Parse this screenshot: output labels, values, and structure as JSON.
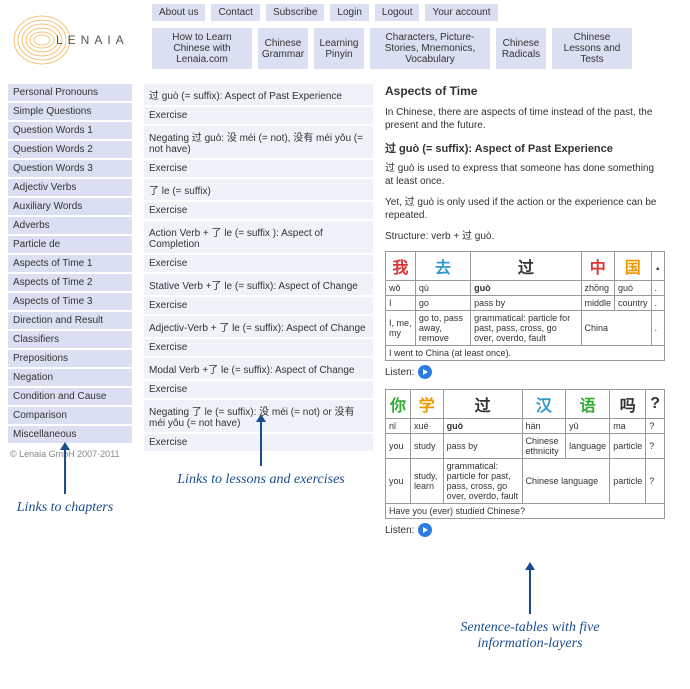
{
  "topnav": [
    "About us",
    "Contact",
    "Subscribe",
    "Login",
    "Logout",
    "Your account"
  ],
  "subnav": [
    "How to Learn Chinese with Lenaia.com",
    "Chinese Grammar",
    "Learning Pinyin",
    "Characters, Picture-Stories, Mnemonics, Vocabulary",
    "Chinese Radicals",
    "Chinese Lessons and Tests"
  ],
  "sidebar": [
    "Personal Pronouns",
    "Simple Questions",
    "Question Words 1",
    "Question Words 2",
    "Question Words 3",
    "Adjectiv Verbs",
    "Auxiliary Words",
    "Adverbs",
    "Particle de",
    "Aspects of Time 1",
    "Aspects of Time 2",
    "Aspects of Time 3",
    "Direction and Result",
    "Classifiers",
    "Prepositions",
    "Negation",
    "Condition and Cause",
    "Comparison",
    "Miscellaneous"
  ],
  "copyright": "© Lenaia GmbH 2007-2011",
  "lessons": [
    "过 guò (= suffix): Aspect of Past Experience",
    "Exercise",
    "Negating 过 guò: 没 méi (= not), 没有 méi yǒu (= not have)",
    "Exercise",
    "了 le (= suffix)",
    "Exercise",
    "Action Verb + 了 le (= suffix ): Aspect of Completion",
    "Exercise",
    "Stative Verb +了 le (= suffix): Aspect of Change",
    "Exercise",
    "Adjectiv-Verb + 了 le (= suffix): Aspect of Change",
    "Exercise",
    "Modal Verb +了 le (= suffix): Aspect of Change",
    "Exercise",
    "Negating 了 le (= suffix): 没 méi (= not) or 没有 méi yǒu (= not have)",
    "Exercise"
  ],
  "content": {
    "title": "Aspects of Time",
    "intro": "In Chinese, there are aspects of time instead of the past, the present and the future.",
    "subtitle": "过 guò (= suffix): Aspect of Past Experience",
    "p1": "过 guò is used to express that someone has done something at least once.",
    "p2": "Yet, 过 guò is only used if the action or the experience can be repeated.",
    "structure": "Structure: verb + 过 guò.",
    "listen": "Listen:",
    "table1": {
      "hanzi": [
        [
          "我",
          "c-red"
        ],
        [
          "去",
          "c-blue"
        ],
        [
          "过",
          "c-dark"
        ],
        [
          "中",
          "c-red"
        ],
        [
          "国",
          "c-orange"
        ],
        [
          ".",
          ""
        ]
      ],
      "pinyin": [
        "wǒ",
        "qù",
        "guò",
        "zhōng",
        "guó",
        "."
      ],
      "pinyin_bold": [
        false,
        false,
        true,
        false,
        false,
        false
      ],
      "gloss": [
        "I",
        "go",
        "pass by",
        "middle",
        "country",
        "."
      ],
      "words": [
        "I, me, my",
        "go to, pass away, remove",
        "grammatical: particle for past, pass, cross, go over, overdo, fault",
        "China",
        "."
      ],
      "words_span": [
        1,
        1,
        1,
        2,
        1
      ],
      "sentence": "I went to China (at least once)."
    },
    "table2": {
      "hanzi": [
        [
          "你",
          "c-green"
        ],
        [
          "学",
          "c-orange"
        ],
        [
          "过",
          "c-dark"
        ],
        [
          "汉",
          "c-blue"
        ],
        [
          "语",
          "c-green"
        ],
        [
          "吗",
          "c-dark"
        ],
        [
          "?",
          ""
        ]
      ],
      "pinyin": [
        "nǐ",
        "xué",
        "guò",
        "hàn",
        "yǔ",
        "ma",
        "?"
      ],
      "pinyin_bold": [
        false,
        false,
        true,
        false,
        false,
        false,
        false
      ],
      "gloss": [
        "you",
        "study",
        "pass by",
        "Chinese ethnicity",
        "language",
        "particle",
        "?"
      ],
      "words": [
        "you",
        "study, learn",
        "grammatical: particle for past, pass, cross, go over, overdo, fault",
        "Chinese language",
        "particle",
        "?"
      ],
      "words_span": [
        1,
        1,
        1,
        2,
        1,
        1
      ],
      "sentence": "Have you (ever) studied Chinese?"
    }
  },
  "annotations": {
    "chapters": "Links to chapters",
    "lessons": "Links to lessons and exercises",
    "tables": "Sentence-tables with five information-layers"
  }
}
